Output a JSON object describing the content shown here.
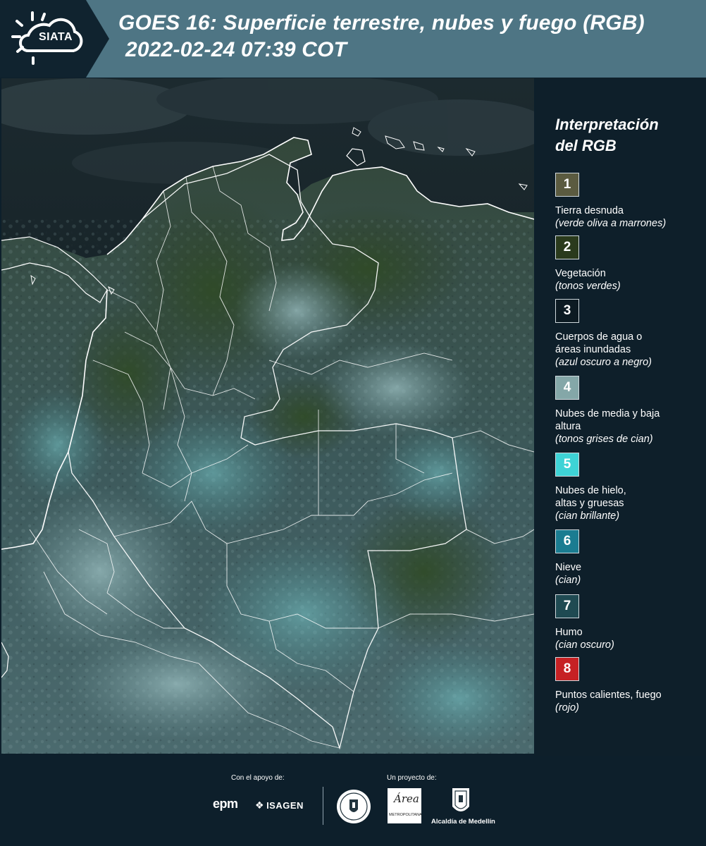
{
  "header": {
    "logo_text": "SIATA",
    "title_line1": "GOES 16: Superficie terrestre, nubes y fuego (RGB)",
    "title_line2": "2022-02-24 07:39 COT"
  },
  "map": {
    "icon": "satellite-rgb-map-colombia"
  },
  "legend": {
    "title_line1": "Interpretación",
    "title_line2": "del RGB",
    "items": [
      {
        "number": "1",
        "color": "#5b5b40",
        "label": "Tierra desnuda",
        "desc": "(verde oliva a marrones)"
      },
      {
        "number": "2",
        "color": "#2a3a1c",
        "label": "Vegetación",
        "desc": "(tonos verdes)"
      },
      {
        "number": "3",
        "color": "#0c1a22",
        "label": "Cuerpos de agua o áreas inundadas",
        "desc": "(azul oscuro a negro)"
      },
      {
        "number": "4",
        "color": "#84a7a8",
        "label": "Nubes de media y baja altura",
        "desc": "(tonos grises de cian)"
      },
      {
        "number": "5",
        "color": "#3ed3d6",
        "label": "Nubes de hielo, altas y gruesas",
        "desc": "(cian brillante)"
      },
      {
        "number": "6",
        "color": "#1a7c91",
        "label": "Nieve",
        "desc": "(cian)"
      },
      {
        "number": "7",
        "color": "#1f4a52",
        "label": "Humo",
        "desc": "(cian oscuro)"
      },
      {
        "number": "8",
        "color": "#c62124",
        "label": "Puntos calientes, fuego",
        "desc": "(rojo)"
      }
    ]
  },
  "footer": {
    "support_caption": "Con el apoyo de:",
    "project_caption": "Un proyecto de:",
    "epm": "epm",
    "isagen": "ISAGEN",
    "area_word": "Área",
    "area_sub": "METROPOLITANA",
    "alcaldia": "Alcaldía de Medellín"
  }
}
